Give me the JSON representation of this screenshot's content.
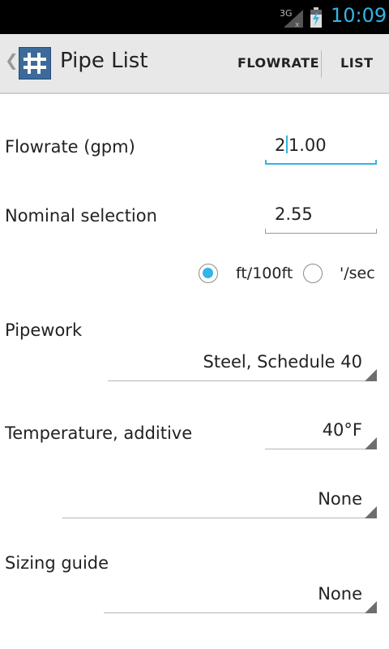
{
  "status_bar": {
    "network": "3G",
    "time": "10:09",
    "time_color": "#33b5e5"
  },
  "action_bar": {
    "title": "Pipe List",
    "actions": [
      "FLOWRATE",
      "LIST"
    ]
  },
  "form": {
    "flowrate": {
      "label": "Flowrate (gpm)",
      "value_before_cursor": "2",
      "value_after_cursor": "1.00"
    },
    "nominal": {
      "label": "Nominal selection",
      "value": "2.55"
    },
    "units": {
      "options": [
        "ft/100ft",
        "'/sec"
      ],
      "selected": "ft/100ft"
    },
    "pipework": {
      "label": "Pipework",
      "value": "Steel, Schedule 40"
    },
    "temperature": {
      "label": "Temperature, additive",
      "value": "40°F"
    },
    "additive": {
      "value": "None"
    },
    "sizing_guide": {
      "label": "Sizing guide",
      "value": "None"
    }
  },
  "accent_color": "#33b5e5"
}
